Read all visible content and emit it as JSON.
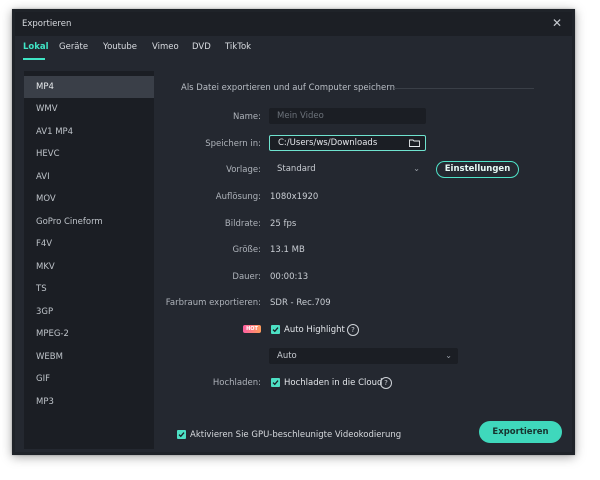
{
  "window": {
    "title": "Exportieren"
  },
  "tabs": [
    "Lokal",
    "Geräte",
    "Youtube",
    "Vimeo",
    "DVD",
    "TikTok"
  ],
  "sidebar": {
    "items": [
      "MP4",
      "WMV",
      "AV1 MP4",
      "HEVC",
      "AVI",
      "MOV",
      "GoPro Cineform",
      "F4V",
      "MKV",
      "TS",
      "3GP",
      "MPEG-2",
      "WEBM",
      "GIF",
      "MP3"
    ],
    "active": "MP4"
  },
  "main": {
    "section_title": "Als Datei exportieren und auf Computer speichern",
    "name": {
      "label": "Name:",
      "placeholder": "Mein Video"
    },
    "save_in": {
      "label": "Speichern in:",
      "value": "C:/Users/ws/Downloads"
    },
    "preset": {
      "label": "Vorlage:",
      "value": "Standard",
      "settings_button": "Einstellungen"
    },
    "resolution": {
      "label": "Auflösung:",
      "value": "1080x1920"
    },
    "framerate": {
      "label": "Bildrate:",
      "value": "25 fps"
    },
    "size": {
      "label": "Größe:",
      "value": "13.1 MB"
    },
    "duration": {
      "label": "Dauer:",
      "value": "00:00:13"
    },
    "colorspace": {
      "label": "Farbraum exportieren:",
      "value": "SDR - Rec.709"
    },
    "auto_highlight": {
      "badge": "HOT",
      "label": "Auto Highlight",
      "checked": true
    },
    "auto_select": {
      "value": "Auto"
    },
    "upload": {
      "label": "Hochladen:",
      "checkbox_label": "Hochladen in die Cloud",
      "checked": true
    },
    "gpu": {
      "label": "Aktivieren Sie GPU-beschleunigte Videokodierung",
      "checked": true
    },
    "export_button": "Exportieren"
  },
  "colors": {
    "accent": "#3fd8bc",
    "background": "#242830",
    "sidebar": "#1b1e24"
  },
  "icons": [
    "close-icon",
    "folder-icon",
    "chevron-down-icon",
    "help-icon",
    "checkbox-check-icon"
  ]
}
